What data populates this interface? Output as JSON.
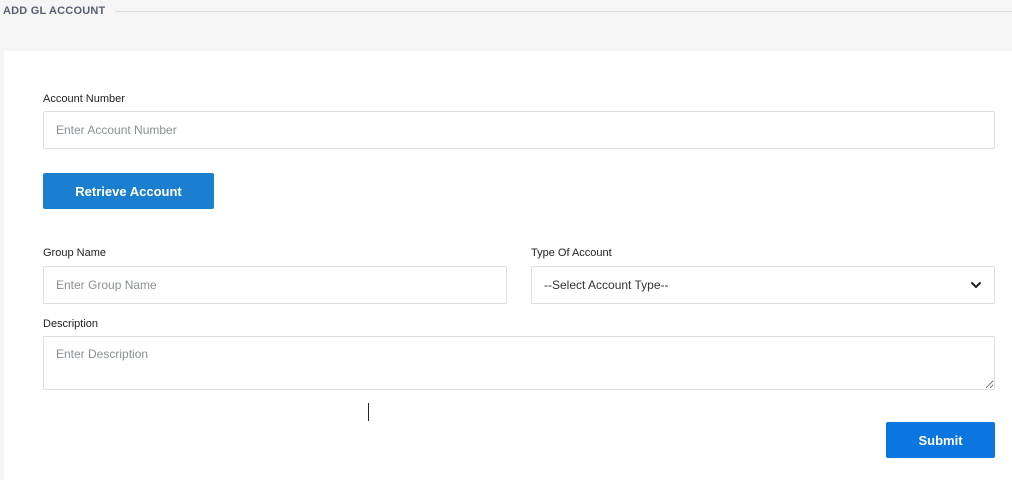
{
  "header": {
    "title": "ADD GL ACCOUNT"
  },
  "form": {
    "account_number": {
      "label": "Account Number",
      "placeholder": "Enter Account Number",
      "value": ""
    },
    "retrieve_button": "Retrieve Account",
    "group_name": {
      "label": "Group Name",
      "placeholder": "Enter Group Name",
      "value": ""
    },
    "account_type": {
      "label": "Type Of Account",
      "selected": "--Select Account Type--",
      "icon": "chevron-down-icon"
    },
    "description": {
      "label": "Description",
      "placeholder": "Enter Description",
      "value": ""
    },
    "submit_button": "Submit"
  },
  "colors": {
    "retrieve_button": "#1b7fcf",
    "submit_button": "#0b76e0",
    "header_text": "#5a6070"
  }
}
